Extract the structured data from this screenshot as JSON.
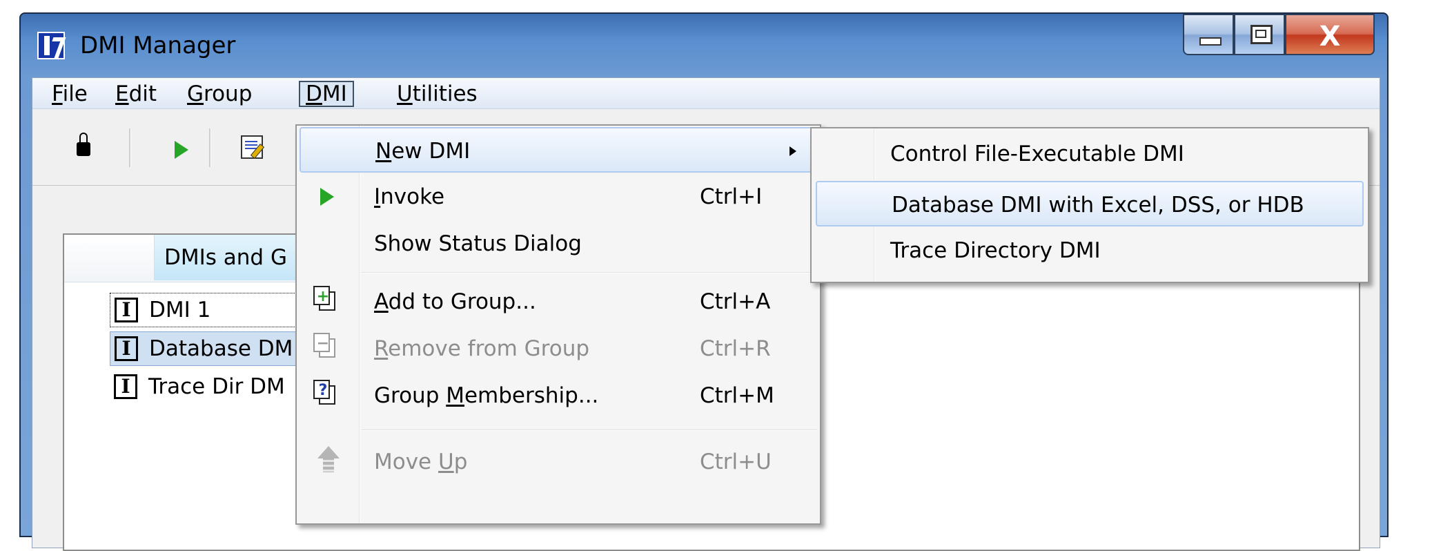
{
  "window": {
    "title": "DMI Manager",
    "close_glyph": "X"
  },
  "menubar": {
    "items": [
      {
        "pre": "",
        "accel": "F",
        "post": "ile"
      },
      {
        "pre": "",
        "accel": "E",
        "post": "dit"
      },
      {
        "pre": "",
        "accel": "G",
        "post": "roup"
      },
      {
        "pre": "",
        "accel": "D",
        "post": "MI"
      },
      {
        "pre": "",
        "accel": "U",
        "post": "tilities"
      }
    ],
    "open_menu": "DMI"
  },
  "toolbar": {
    "icons": [
      "lock-icon",
      "play-icon",
      "edit-icon"
    ]
  },
  "tree": {
    "header": "DMIs and G",
    "rows": [
      {
        "icon_glyph": "I",
        "label": "DMI 1",
        "state": "focus"
      },
      {
        "icon_glyph": "I",
        "label": "Database DM",
        "state": "selected"
      },
      {
        "icon_glyph": "I",
        "label": "Trace Dir DM",
        "state": "normal"
      }
    ]
  },
  "dmi_menu": {
    "items": [
      {
        "pre": "",
        "accel": "N",
        "post": "ew DMI",
        "shortcut": "",
        "submenu": true,
        "state": "hover"
      },
      {
        "pre": "",
        "accel": "I",
        "post": "nvoke",
        "shortcut": "Ctrl+I",
        "icon": "play-icon",
        "state": "enabled"
      },
      {
        "pre": "Show Status Dialog",
        "accel": "",
        "post": "",
        "shortcut": "",
        "state": "enabled"
      },
      {
        "pre": "",
        "accel": "A",
        "post": "dd to Group...",
        "shortcut": "Ctrl+A",
        "icon": "add-to-group-icon",
        "state": "enabled"
      },
      {
        "pre": "",
        "accel": "R",
        "post": "emove from Group",
        "shortcut": "Ctrl+R",
        "icon": "remove-from-group-icon",
        "state": "disabled"
      },
      {
        "pre": "Group ",
        "accel": "M",
        "post": "embership...",
        "shortcut": "Ctrl+M",
        "icon": "group-membership-icon",
        "state": "enabled"
      },
      {
        "pre": "Move ",
        "accel": "U",
        "post": "p",
        "shortcut": "Ctrl+U",
        "icon": "move-up-icon",
        "state": "disabled"
      }
    ]
  },
  "new_dmi_submenu": {
    "items": [
      {
        "label": "Control File-Executable DMI",
        "state": "enabled"
      },
      {
        "label": "Database DMI with Excel, DSS, or HDB",
        "state": "hover"
      },
      {
        "label": "Trace Directory DMI",
        "state": "enabled"
      }
    ]
  },
  "colors": {
    "title_bar": "#5a8fd0",
    "menu_hover_border": "#aecaf0",
    "play_green": "#27a527",
    "disabled_text": "#8d8d8d"
  }
}
